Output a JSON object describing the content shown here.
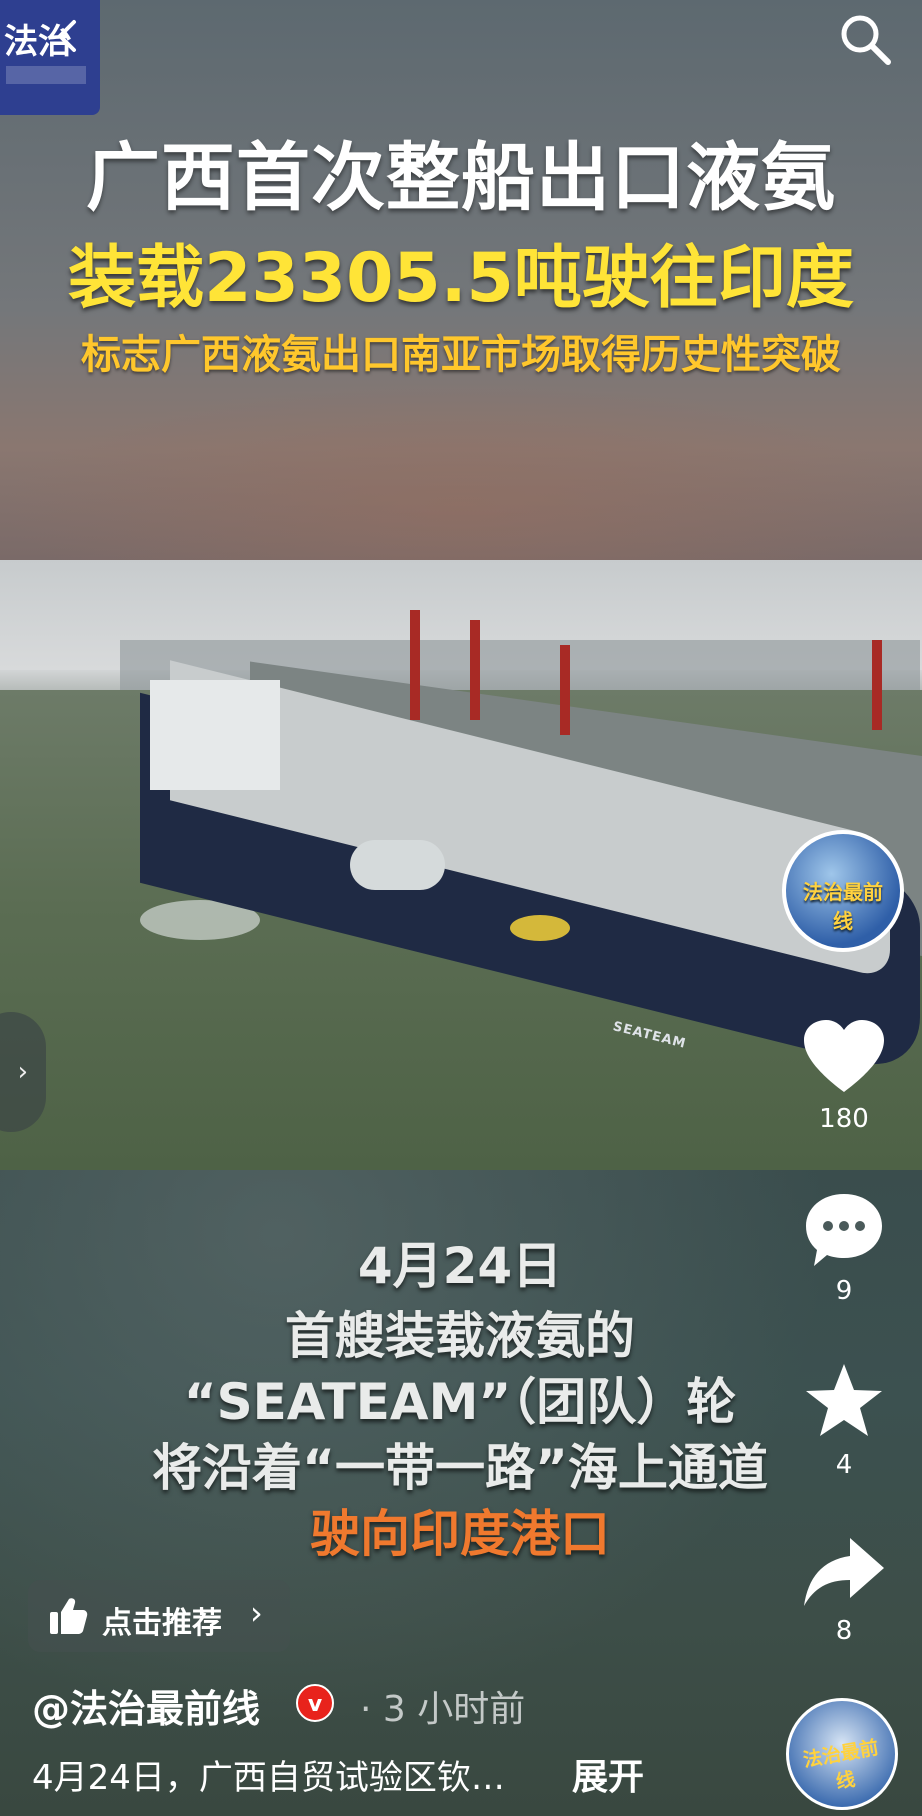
{
  "channel": {
    "logo_text": "法治",
    "avatar_label": "法治最前线"
  },
  "headline": {
    "line1": "广西首次整船出口液氨",
    "line2": "装载23305.5吨驶往印度",
    "line3": "标志广西液氨出口南亚市场取得历史性突破"
  },
  "video": {
    "ship_name": "SEATEAM"
  },
  "caption": {
    "line1": "4月24日",
    "line2": "首艘装载液氨的",
    "line3": "“SEATEAM”（团队）轮",
    "line4": "将沿着“一带一路”海上通道",
    "line5": "驶向印度港口"
  },
  "actions": {
    "like_count": "180",
    "comment_count": "9",
    "favorite_count": "4",
    "share_count": "8"
  },
  "recommend": {
    "label": "点击推荐"
  },
  "post": {
    "author": "@法治最前线",
    "verified_badge": "v",
    "time": "· 3 小时前",
    "description": "4月24日，广西自贸试验区钦…",
    "expand_label": "展开"
  },
  "colors": {
    "headline_yellow": "#ffe437",
    "caption_orange": "#f0792e",
    "verified_red": "#e8231c"
  },
  "icons": [
    "back-icon",
    "search-icon",
    "heart-icon",
    "comment-icon",
    "star-icon",
    "share-icon",
    "thumb-up-icon",
    "chevron-right-icon"
  ]
}
